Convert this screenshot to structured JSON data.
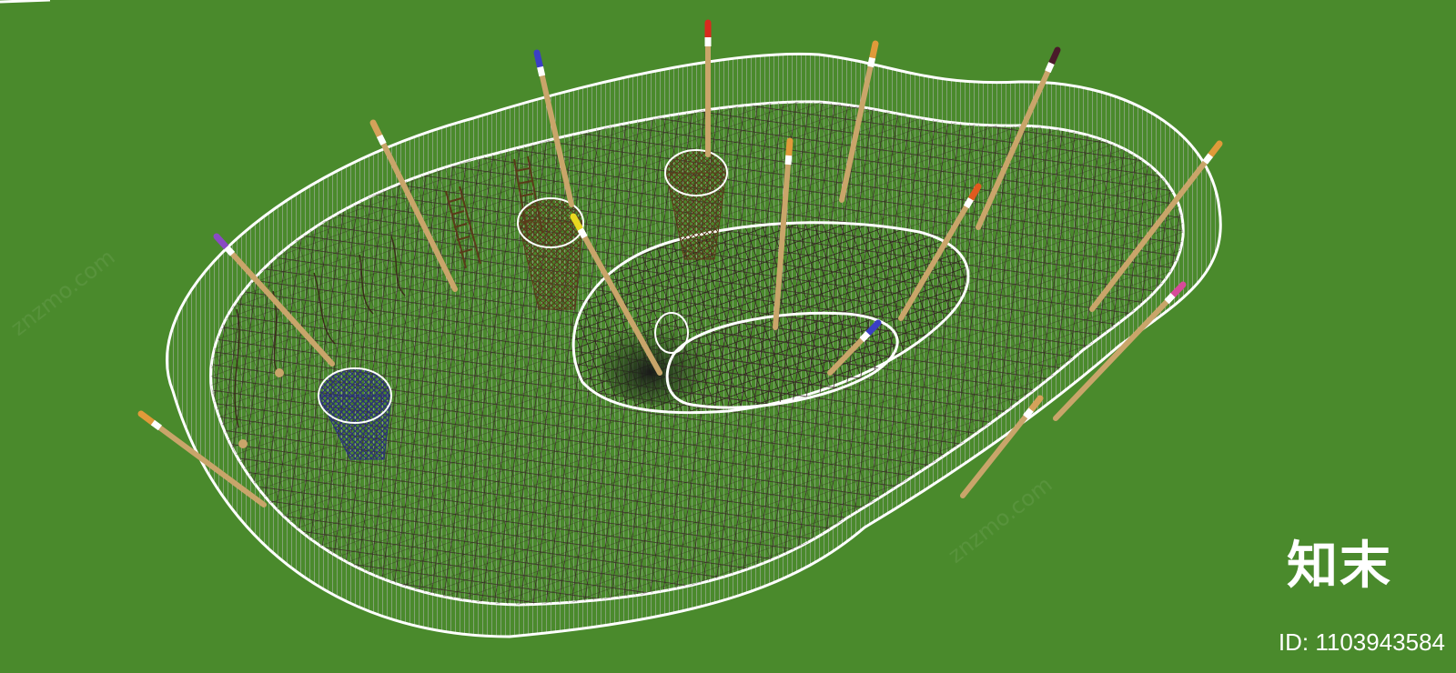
{
  "watermark": {
    "logo_text": "知末",
    "id_text": "ID: 1103943584"
  },
  "colors": {
    "grass": "#4a8a2c",
    "net": "#3b2a2a",
    "rim": "#ffffff",
    "pole": "#c9a56a",
    "barrel": "#5a3a1a",
    "blue_basket": "#2a2f7a"
  },
  "poles": [
    {
      "name": "pole-orange-left",
      "cap": "#e09a3a"
    },
    {
      "name": "pole-blue",
      "cap": "#3b3fc4"
    },
    {
      "name": "pole-red",
      "cap": "#d92a1e"
    },
    {
      "name": "pole-orange-top",
      "cap": "#e09a3a"
    },
    {
      "name": "pole-dark",
      "cap": "#4a1a2a"
    },
    {
      "name": "pole-orange-right",
      "cap": "#e09a3a"
    },
    {
      "name": "pole-purple",
      "cap": "#8a4ac4"
    },
    {
      "name": "pole-yellow",
      "cap": "#e8d820"
    },
    {
      "name": "pole-orange-center",
      "cap": "#e09a3a"
    },
    {
      "name": "pole-red-mid",
      "cap": "#e05a1e"
    },
    {
      "name": "pole-pink",
      "cap": "#d84a9a"
    },
    {
      "name": "pole-tan-front",
      "cap": "#d4a25a"
    },
    {
      "name": "pole-orange-front-left",
      "cap": "#d4a25a"
    },
    {
      "name": "pole-blue-small",
      "cap": "#3b3fc4"
    }
  ]
}
